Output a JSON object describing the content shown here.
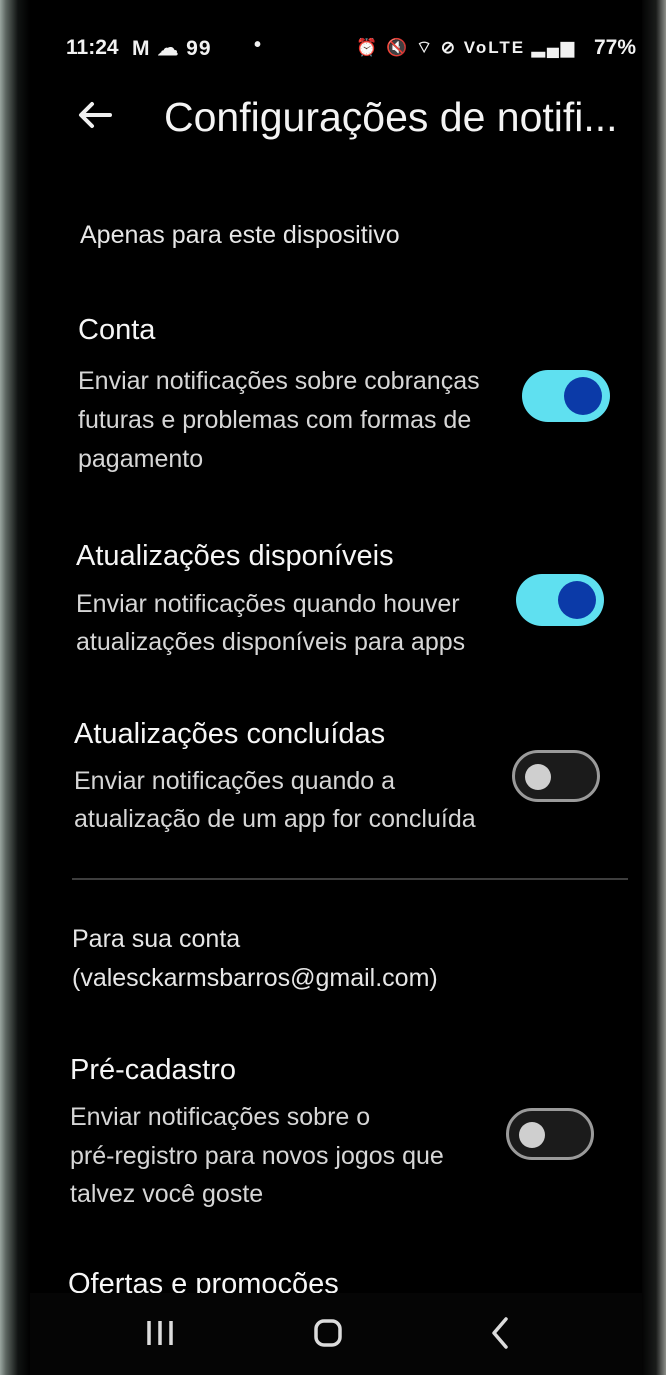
{
  "status_bar": {
    "time": "11:24",
    "left_icons": "M ☁ 99",
    "dot": "•",
    "right_icons": "⏰ 🔇 ⌔ ⊘ VoLTE ▂▄▆",
    "battery": "77%"
  },
  "header": {
    "back_icon": "arrow-left",
    "title": "Configurações de notifi..."
  },
  "device_section": {
    "label": "Apenas para este dispositivo"
  },
  "items": [
    {
      "title": "Conta",
      "description_lines": [
        "Enviar notificações sobre cobranças",
        "futuras e problemas com formas de",
        "pagamento"
      ],
      "enabled": true
    },
    {
      "title": "Atualizações disponíveis",
      "description_lines": [
        "Enviar notificações quando houver",
        "atualizações disponíveis para apps"
      ],
      "enabled": true
    },
    {
      "title": "Atualizações concluídas",
      "description_lines": [
        "Enviar notificações quando a",
        "atualização de um app for concluída"
      ],
      "enabled": false
    }
  ],
  "account_section": {
    "label_line1": "Para sua conta",
    "label_line2": "(valesckarmsbarros@gmail.com)"
  },
  "account_items": [
    {
      "title": "Pré-cadastro",
      "description_lines": [
        "Enviar notificações sobre o",
        "pré-registro para novos jogos que",
        "talvez você goste"
      ],
      "enabled": false
    },
    {
      "title": "Ofertas e promoções"
    }
  ],
  "nav": {
    "recents": "|||",
    "home": "▢",
    "back": "‹"
  },
  "colors": {
    "toggle_on_track": "#5fe0f0",
    "toggle_on_knob": "#0b3aa8",
    "background": "#000000"
  }
}
